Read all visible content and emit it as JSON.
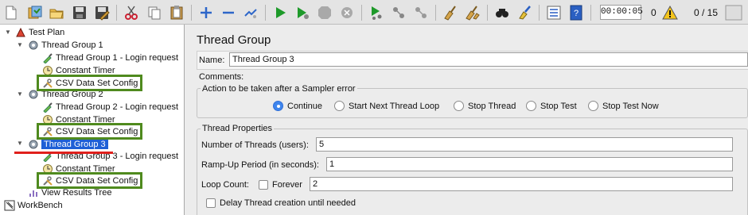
{
  "toolbar": {
    "buttons": [
      "new-icon",
      "templates-icon",
      "open-icon",
      "save-icon",
      "save-as-icon",
      "cut-icon",
      "copy-icon",
      "paste-icon",
      "expand-icon",
      "collapse-icon",
      "toggle-icon",
      "start-icon",
      "start-no-pauses-icon",
      "stop-icon",
      "shutdown-icon",
      "remote-start-icon",
      "remote-stop-icon",
      "remote-shutdown-icon",
      "clear-icon",
      "clear-all-icon",
      "search-icon",
      "reset-search-icon",
      "function-helper-icon",
      "help-icon"
    ],
    "timer": "00:00:05",
    "error_count": "0",
    "thread_count": "0 / 15"
  },
  "tree": {
    "nodes": [
      {
        "label": "Test Plan",
        "icon": "test-plan-icon"
      },
      {
        "label": "Thread Group 1",
        "icon": "gear-icon"
      },
      {
        "label": "Thread Group 1 - Login request",
        "icon": "pipette-icon"
      },
      {
        "label": "Constant Timer",
        "icon": "timer-icon"
      },
      {
        "label": "CSV Data Set Config",
        "icon": "wrench-icon"
      },
      {
        "label": "Thread Group 2",
        "icon": "gear-icon"
      },
      {
        "label": "Thread Group 2 - Login request",
        "icon": "pipette-icon"
      },
      {
        "label": "Constant Timer",
        "icon": "timer-icon"
      },
      {
        "label": "CSV Data Set Config",
        "icon": "wrench-icon"
      },
      {
        "label": "Thread Group 3",
        "icon": "gear-icon"
      },
      {
        "label": "Thread Group 3 - Login request",
        "icon": "pipette-icon"
      },
      {
        "label": "Constant Timer",
        "icon": "timer-icon"
      },
      {
        "label": "CSV Data Set Config",
        "icon": "wrench-icon"
      },
      {
        "label": "View Results Tree",
        "icon": "chart-icon"
      },
      {
        "label": "WorkBench",
        "icon": "workbench-icon"
      }
    ],
    "selected_index": 9,
    "highlight_color": "#4f8a1e",
    "underline_color": "#e0201c"
  },
  "panel": {
    "title": "Thread Group",
    "name_label": "Name:",
    "name_value": "Thread Group 3",
    "comments_label": "Comments:",
    "error_action": {
      "legend": "Action to be taken after a Sampler error",
      "options": [
        "Continue",
        "Start Next Thread Loop",
        "Stop Thread",
        "Stop Test",
        "Stop Test Now"
      ],
      "selected": "Continue"
    },
    "thread_properties": {
      "legend": "Thread Properties",
      "num_threads_label": "Number of Threads (users):",
      "num_threads_value": "5",
      "ramp_up_label": "Ramp-Up Period (in seconds):",
      "ramp_up_value": "1",
      "loop_count_label": "Loop Count:",
      "forever_label": "Forever",
      "forever_checked": false,
      "loop_count_value": "2",
      "delay_label": "Delay Thread creation until needed",
      "delay_checked": false
    }
  }
}
